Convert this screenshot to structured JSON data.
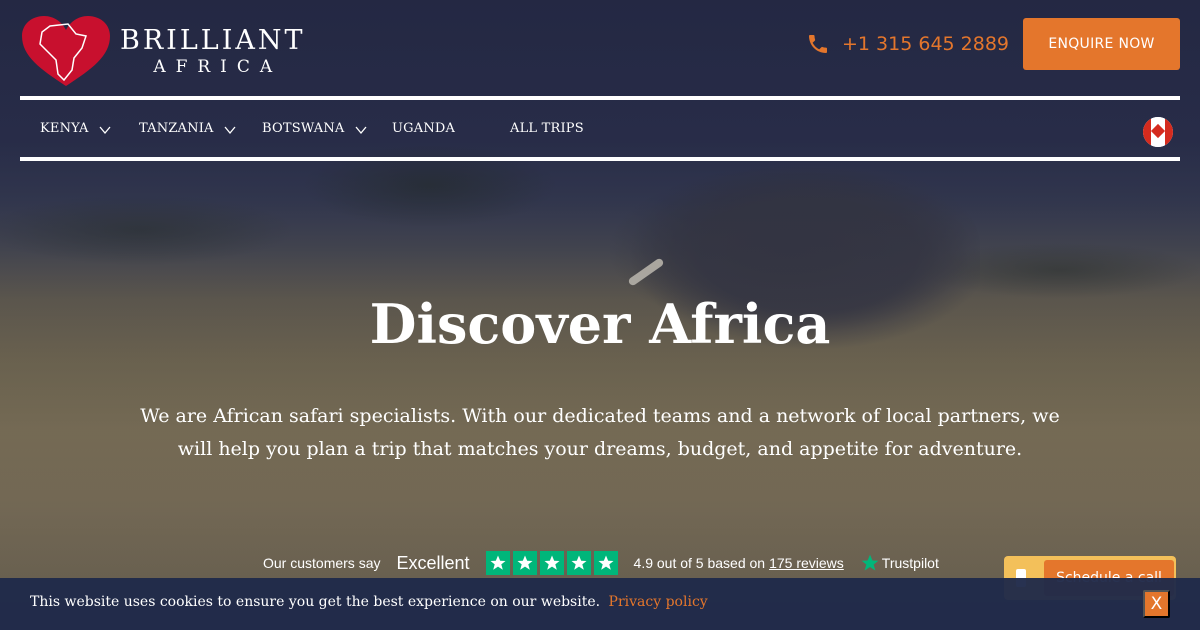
{
  "brand": {
    "name": "BRILLIANT",
    "sub": "AFRICA",
    "logo_icon": "africa-heart-icon",
    "accent_color": "#e4762c",
    "logo_color": "#c8102e"
  },
  "header": {
    "phone": "+1 315 645 2889",
    "phone_icon": "phone-icon",
    "enquire_label": "ENQUIRE NOW"
  },
  "nav": {
    "items": [
      {
        "label": "KENYA",
        "has_dropdown": true
      },
      {
        "label": "TANZANIA",
        "has_dropdown": true
      },
      {
        "label": "BOTSWANA",
        "has_dropdown": true
      },
      {
        "label": "UGANDA",
        "has_dropdown": false
      },
      {
        "label": "ALL TRIPS",
        "has_dropdown": false
      }
    ],
    "flag_icon": "canada-flag-icon"
  },
  "hero": {
    "title": "Discover Africa",
    "description": "We are African safari specialists. With our dedicated teams and a network of local partners, we will help you plan a trip that matches your dreams, budget, and appetite for adventure."
  },
  "trustpilot": {
    "say": "Our customers say",
    "rating_word": "Excellent",
    "stars": 5,
    "score_text": "4.9 out of 5 based on",
    "reviews_link": "175 reviews",
    "brand": "Trustpilot",
    "star_color": "#00b67a"
  },
  "schedule": {
    "label": "Schedule a call"
  },
  "cookie": {
    "text": "This website uses cookies to ensure you get the best experience on our website.",
    "link": "Privacy policy",
    "close": "X"
  }
}
